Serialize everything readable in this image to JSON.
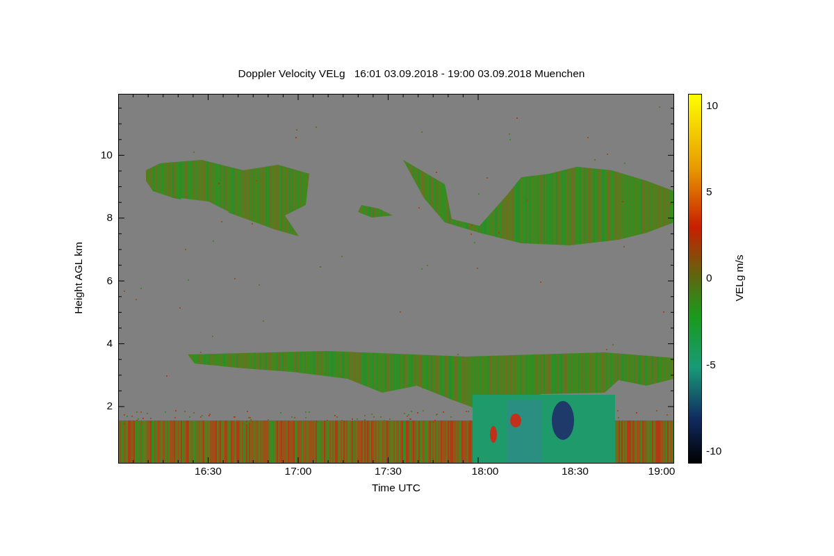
{
  "title": "Doppler Velocity VELg   16:01 03.09.2018 - 19:00 03.09.2018 Muenchen",
  "y_axis": {
    "label": "Height AGL km",
    "ticks": [
      "10",
      "8",
      "6",
      "4",
      "2"
    ]
  },
  "x_axis": {
    "label": "Time UTC",
    "ticks": [
      "16:30",
      "17:00",
      "17:30",
      "18:00",
      "18:30",
      "19:00"
    ]
  },
  "colorbar": {
    "label": "VELg m/s",
    "ticks": [
      "10",
      "5",
      "0",
      "-5",
      "-10"
    ]
  }
}
